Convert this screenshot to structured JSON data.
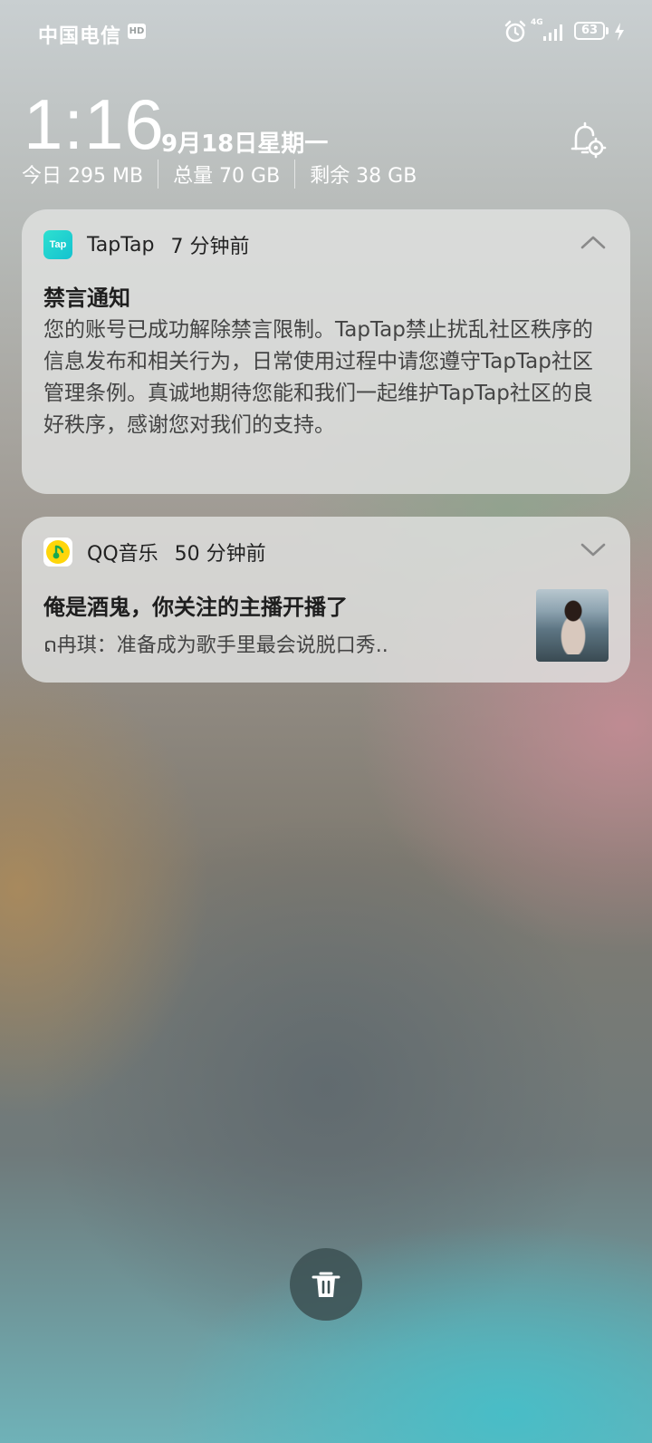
{
  "status_bar": {
    "carrier": "中国电信",
    "hd_badge": "HD",
    "network": "4G",
    "battery": "63"
  },
  "header": {
    "time": "1:16",
    "date": "9月18日星期一",
    "storage": {
      "today": "今日 295 MB",
      "total": "总量 70 GB",
      "remaining": "剩余 38 GB"
    }
  },
  "notifications": [
    {
      "app": "TapTap",
      "app_icon_text": "Tap",
      "time_ago": "7 分钟前",
      "title": "禁言通知",
      "body": "您的账号已成功解除禁言限制。TapTap禁止扰乱社区秩序的信息发布和相关行为，日常使用过程中请您遵守TapTap社区管理条例。真诚地期待您能和我们一起维护TapTap社区的良好秩序，感谢您对我们的支持。",
      "expanded": true
    },
    {
      "app": "QQ音乐",
      "time_ago": "50 分钟前",
      "title": "俺是酒鬼，你关注的主播开播了",
      "body": "ດ冉琪：准备成为歌手里最会说脱口秀..",
      "expanded": false
    }
  ],
  "icons": {
    "alarm": "alarm-icon",
    "signal": "signal-icon",
    "charging": "charging-icon",
    "notification_settings": "bell-settings-icon",
    "collapse": "chevron-up-icon",
    "expand": "chevron-down-icon",
    "clear_all": "trash-icon"
  },
  "colors": {
    "taptap_brand": "#15c5ce",
    "qq_music_brand": "#ffd60a",
    "card_background": "#e1e2e0",
    "clear_button": "#3c5052"
  }
}
